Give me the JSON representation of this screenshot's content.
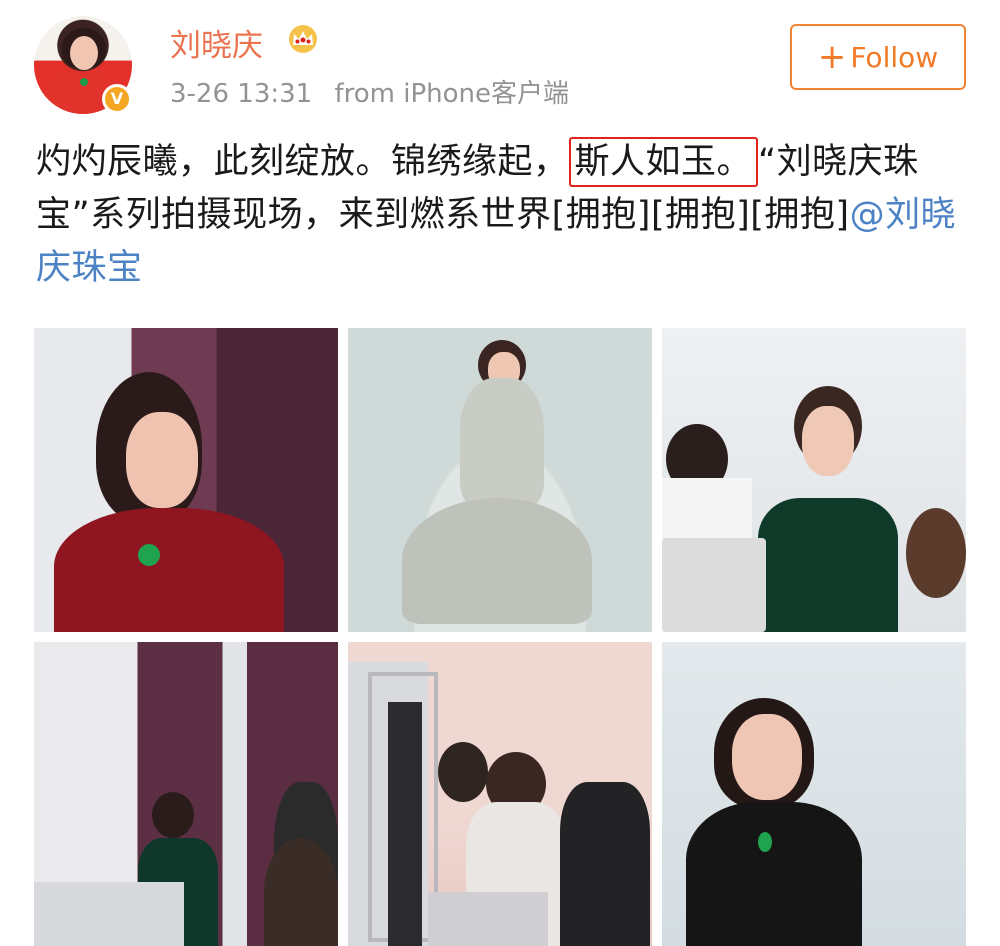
{
  "header": {
    "username": "刘晓庆",
    "crown_icon": "crown-icon",
    "timestamp": "3-26 13:31",
    "source": "from iPhone客户端",
    "follow_label": "Follow",
    "verified_badge": "V"
  },
  "post": {
    "text_part1": "灼灼辰曦，此刻绽放。锦绣缘起，",
    "highlighted": "斯人如玉。",
    "text_part2": "“刘晓庆珠宝”系列拍摄现场，来到燃系世界[拥抱][拥抱][拥抱]",
    "mention": "@刘晓庆珠宝"
  },
  "colors": {
    "username": "#eb7350",
    "follow_border": "#f08334",
    "highlight_box": "#e0241c",
    "mention": "#4d83c4"
  },
  "photos": [
    {
      "name": "photo-red-dress-portrait"
    },
    {
      "name": "photo-white-gown-fullbody"
    },
    {
      "name": "photo-green-dress-fitting"
    },
    {
      "name": "photo-studio-seated"
    },
    {
      "name": "photo-studio-group"
    },
    {
      "name": "photo-black-dress-portrait"
    }
  ]
}
